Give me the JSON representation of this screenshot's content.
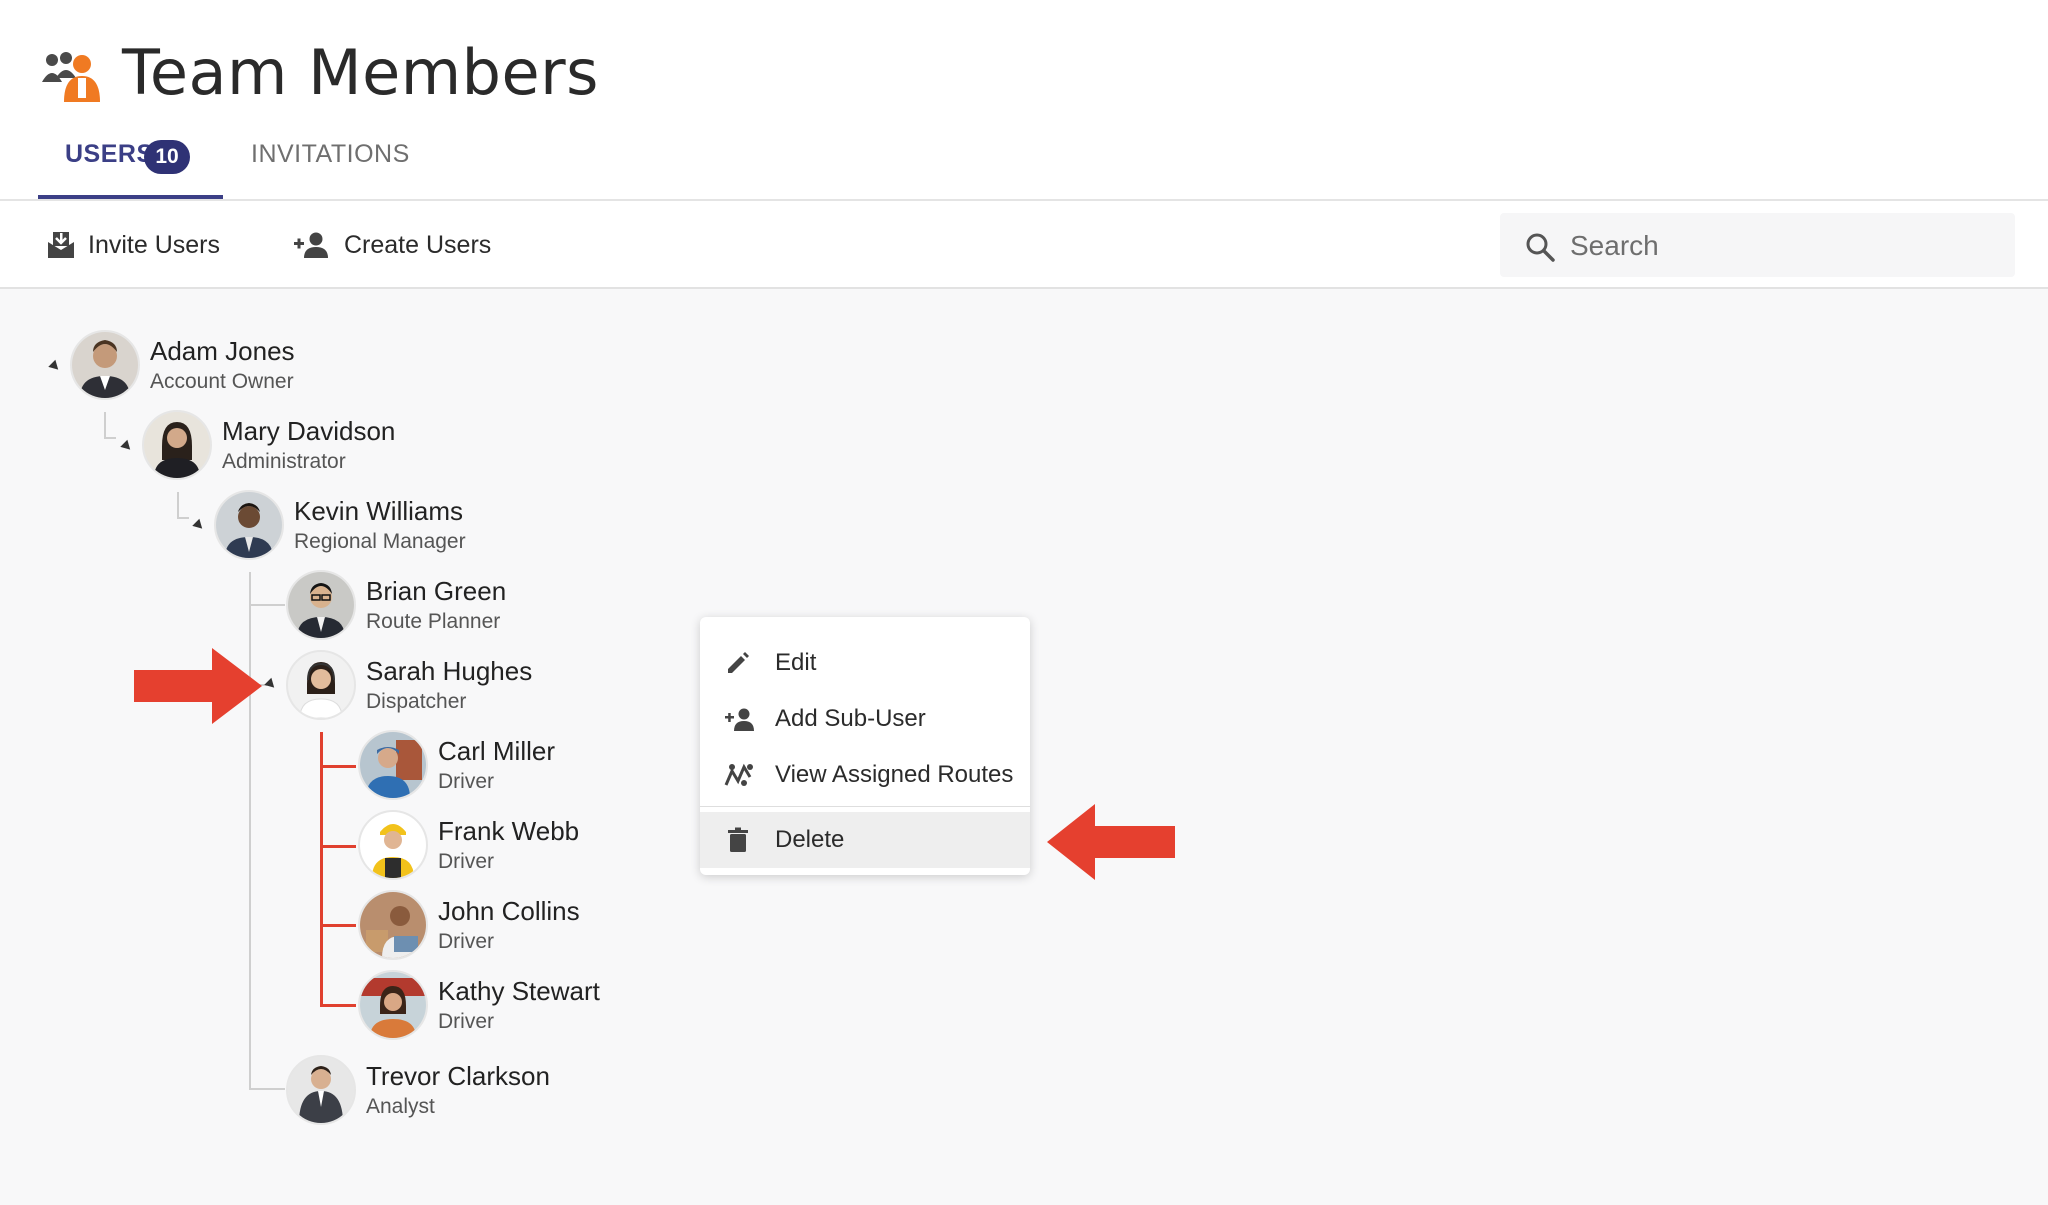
{
  "page": {
    "title": "Team Members"
  },
  "tabs": [
    {
      "label": "USERS",
      "badge": "10"
    },
    {
      "label": "INVITATIONS"
    }
  ],
  "toolbar": {
    "invite_label": "Invite Users",
    "create_label": "Create Users",
    "search_placeholder": "Search"
  },
  "users": [
    {
      "name": "Adam Jones",
      "role": "Account Owner"
    },
    {
      "name": "Mary Davidson",
      "role": "Administrator"
    },
    {
      "name": "Kevin Williams",
      "role": "Regional Manager"
    },
    {
      "name": "Brian Green",
      "role": "Route Planner"
    },
    {
      "name": "Sarah Hughes",
      "role": "Dispatcher"
    },
    {
      "name": "Carl Miller",
      "role": "Driver"
    },
    {
      "name": "Frank Webb",
      "role": "Driver"
    },
    {
      "name": "John Collins",
      "role": "Driver"
    },
    {
      "name": "Kathy Stewart",
      "role": "Driver"
    },
    {
      "name": "Trevor Clarkson",
      "role": "Analyst"
    }
  ],
  "context_menu": {
    "items": [
      {
        "label": "Edit",
        "icon": "pencil-icon"
      },
      {
        "label": "Add Sub-User",
        "icon": "add-user-icon"
      },
      {
        "label": "View Assigned Routes",
        "icon": "routes-icon"
      },
      {
        "label": "Delete",
        "icon": "trash-icon"
      }
    ]
  },
  "colors": {
    "accent": "#3b3f86",
    "badge": "#2f3275",
    "highlight_red": "#e0402f",
    "brand_orange": "#f07a22"
  }
}
